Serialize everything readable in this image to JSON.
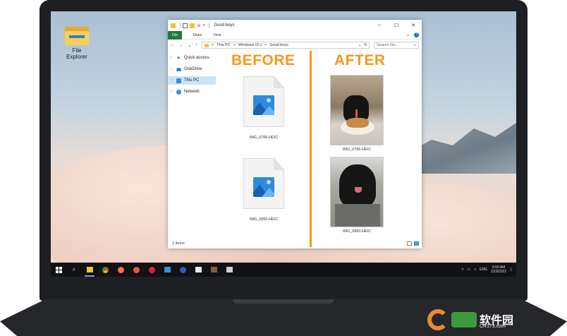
{
  "desktop": {
    "icon_label": "File\nExplorer"
  },
  "window": {
    "title": "Good boys",
    "controls": {
      "minimize": "–",
      "maximize": "☐",
      "close": "✕"
    },
    "ribbon_tabs": [
      "File",
      "Home",
      "Share",
      "View"
    ],
    "address": {
      "breadcrumb": [
        "This PC",
        "Windows (C:)",
        "Good boys"
      ],
      "separator": ">"
    },
    "search_placeholder": "Search Go...",
    "nav_items": [
      {
        "label": "Quick access",
        "icon": "star-icon"
      },
      {
        "label": "OneDrive",
        "icon": "cloud-icon"
      },
      {
        "label": "This PC",
        "icon": "computer-icon",
        "selected": true
      },
      {
        "label": "Network",
        "icon": "network-icon"
      }
    ],
    "status": "2 items"
  },
  "comparison": {
    "before_heading": "BEFORE",
    "after_heading": "AFTER",
    "accent_color": "#f39a1b",
    "before_files": [
      "IMG_0766.HEIC",
      "IMG_0850.HEIC"
    ],
    "after_files": [
      "IMG_0766.HEIC",
      "IMG_0850.HEIC"
    ]
  },
  "taskbar": {
    "language": "ENG",
    "time": "9:50 AM",
    "date": "1/19/2021"
  },
  "watermark": {
    "text": "软件园",
    "sub": "CR173.com"
  }
}
